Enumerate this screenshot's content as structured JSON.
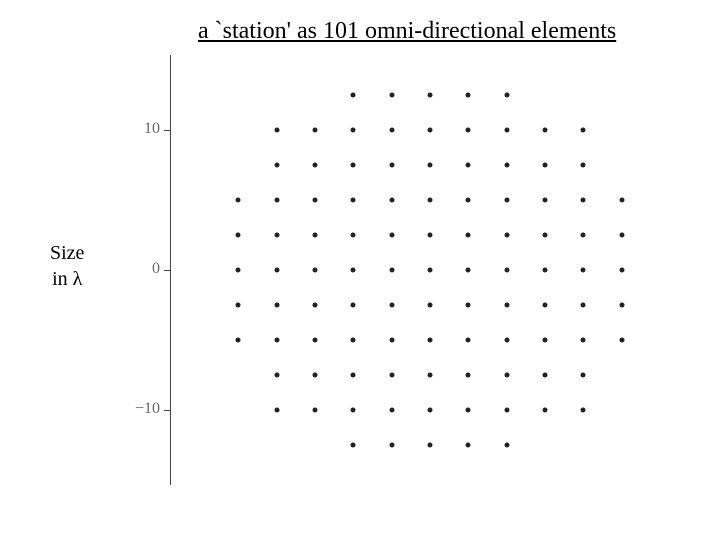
{
  "title": "a `station' as 101  omni-directional elements",
  "ylabel_line1": "Size",
  "ylabel_line2": "in ",
  "ylabel_lambda": "λ",
  "y_ticks": [
    {
      "value": 10,
      "label": "10"
    },
    {
      "value": 0,
      "label": "0"
    },
    {
      "value": -10,
      "label": "−10"
    }
  ],
  "chart_data": {
    "type": "scatter",
    "title": "a `station' as 101 omni-directional elements",
    "xlabel": "",
    "ylabel": "Size in λ",
    "xlim": [
      -15,
      15
    ],
    "ylim": [
      -15,
      15
    ],
    "grid": false,
    "legend": false,
    "spacing": 2.5,
    "points": [
      {
        "x": -5.0,
        "y": 12.5
      },
      {
        "x": -2.5,
        "y": 12.5
      },
      {
        "x": 0.0,
        "y": 12.5
      },
      {
        "x": 2.5,
        "y": 12.5
      },
      {
        "x": 5.0,
        "y": 12.5
      },
      {
        "x": -10.0,
        "y": 10.0
      },
      {
        "x": -7.5,
        "y": 10.0
      },
      {
        "x": -5.0,
        "y": 10.0
      },
      {
        "x": -2.5,
        "y": 10.0
      },
      {
        "x": 0.0,
        "y": 10.0
      },
      {
        "x": 2.5,
        "y": 10.0
      },
      {
        "x": 5.0,
        "y": 10.0
      },
      {
        "x": 7.5,
        "y": 10.0
      },
      {
        "x": 10.0,
        "y": 10.0
      },
      {
        "x": -10.0,
        "y": 7.5
      },
      {
        "x": -7.5,
        "y": 7.5
      },
      {
        "x": -5.0,
        "y": 7.5
      },
      {
        "x": -2.5,
        "y": 7.5
      },
      {
        "x": 0.0,
        "y": 7.5
      },
      {
        "x": 2.5,
        "y": 7.5
      },
      {
        "x": 5.0,
        "y": 7.5
      },
      {
        "x": 7.5,
        "y": 7.5
      },
      {
        "x": 10.0,
        "y": 7.5
      },
      {
        "x": -12.5,
        "y": 5.0
      },
      {
        "x": -10.0,
        "y": 5.0
      },
      {
        "x": -7.5,
        "y": 5.0
      },
      {
        "x": -5.0,
        "y": 5.0
      },
      {
        "x": -2.5,
        "y": 5.0
      },
      {
        "x": 0.0,
        "y": 5.0
      },
      {
        "x": 2.5,
        "y": 5.0
      },
      {
        "x": 5.0,
        "y": 5.0
      },
      {
        "x": 7.5,
        "y": 5.0
      },
      {
        "x": 10.0,
        "y": 5.0
      },
      {
        "x": 12.5,
        "y": 5.0
      },
      {
        "x": -12.5,
        "y": 2.5
      },
      {
        "x": -10.0,
        "y": 2.5
      },
      {
        "x": -7.5,
        "y": 2.5
      },
      {
        "x": -5.0,
        "y": 2.5
      },
      {
        "x": -2.5,
        "y": 2.5
      },
      {
        "x": 0.0,
        "y": 2.5
      },
      {
        "x": 2.5,
        "y": 2.5
      },
      {
        "x": 5.0,
        "y": 2.5
      },
      {
        "x": 7.5,
        "y": 2.5
      },
      {
        "x": 10.0,
        "y": 2.5
      },
      {
        "x": 12.5,
        "y": 2.5
      },
      {
        "x": -12.5,
        "y": 0.0
      },
      {
        "x": -10.0,
        "y": 0.0
      },
      {
        "x": -7.5,
        "y": 0.0
      },
      {
        "x": -5.0,
        "y": 0.0
      },
      {
        "x": -2.5,
        "y": 0.0
      },
      {
        "x": 0.0,
        "y": 0.0
      },
      {
        "x": 2.5,
        "y": 0.0
      },
      {
        "x": 5.0,
        "y": 0.0
      },
      {
        "x": 7.5,
        "y": 0.0
      },
      {
        "x": 10.0,
        "y": 0.0
      },
      {
        "x": 12.5,
        "y": 0.0
      },
      {
        "x": -12.5,
        "y": -2.5
      },
      {
        "x": -10.0,
        "y": -2.5
      },
      {
        "x": -7.5,
        "y": -2.5
      },
      {
        "x": -5.0,
        "y": -2.5
      },
      {
        "x": -2.5,
        "y": -2.5
      },
      {
        "x": 0.0,
        "y": -2.5
      },
      {
        "x": 2.5,
        "y": -2.5
      },
      {
        "x": 5.0,
        "y": -2.5
      },
      {
        "x": 7.5,
        "y": -2.5
      },
      {
        "x": 10.0,
        "y": -2.5
      },
      {
        "x": 12.5,
        "y": -2.5
      },
      {
        "x": -12.5,
        "y": -5.0
      },
      {
        "x": -10.0,
        "y": -5.0
      },
      {
        "x": -7.5,
        "y": -5.0
      },
      {
        "x": -5.0,
        "y": -5.0
      },
      {
        "x": -2.5,
        "y": -5.0
      },
      {
        "x": 0.0,
        "y": -5.0
      },
      {
        "x": 2.5,
        "y": -5.0
      },
      {
        "x": 5.0,
        "y": -5.0
      },
      {
        "x": 7.5,
        "y": -5.0
      },
      {
        "x": 10.0,
        "y": -5.0
      },
      {
        "x": 12.5,
        "y": -5.0
      },
      {
        "x": -10.0,
        "y": -7.5
      },
      {
        "x": -7.5,
        "y": -7.5
      },
      {
        "x": -5.0,
        "y": -7.5
      },
      {
        "x": -2.5,
        "y": -7.5
      },
      {
        "x": 0.0,
        "y": -7.5
      },
      {
        "x": 2.5,
        "y": -7.5
      },
      {
        "x": 5.0,
        "y": -7.5
      },
      {
        "x": 7.5,
        "y": -7.5
      },
      {
        "x": 10.0,
        "y": -7.5
      },
      {
        "x": -10.0,
        "y": -10.0
      },
      {
        "x": -7.5,
        "y": -10.0
      },
      {
        "x": -5.0,
        "y": -10.0
      },
      {
        "x": -2.5,
        "y": -10.0
      },
      {
        "x": 0.0,
        "y": -10.0
      },
      {
        "x": 2.5,
        "y": -10.0
      },
      {
        "x": 5.0,
        "y": -10.0
      },
      {
        "x": 7.5,
        "y": -10.0
      },
      {
        "x": 10.0,
        "y": -10.0
      },
      {
        "x": -5.0,
        "y": -12.5
      },
      {
        "x": -2.5,
        "y": -12.5
      },
      {
        "x": 0.0,
        "y": -12.5
      },
      {
        "x": 2.5,
        "y": -12.5
      },
      {
        "x": 5.0,
        "y": -12.5
      }
    ]
  }
}
